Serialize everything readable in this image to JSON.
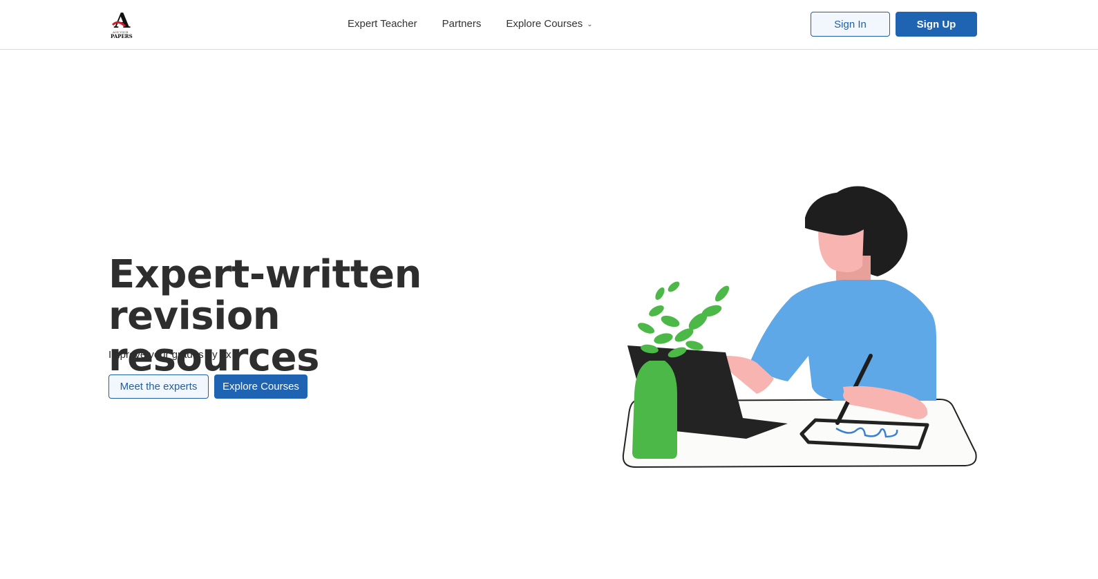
{
  "header": {
    "logo_icon": "ace-your-papers-logo",
    "logo_text": "PAPERS",
    "nav": [
      {
        "label": "Expert Teacher"
      },
      {
        "label": "Partners"
      },
      {
        "label": "Explore Courses",
        "icon": "chevron-down-icon"
      }
    ],
    "sign_in": "Sign In",
    "sign_up": "Sign Up"
  },
  "hero": {
    "title_line1": "Expert-written",
    "title_line2": "revision resources",
    "subtitle": "Improve your grades by 2x",
    "primary_button": "Meet the experts",
    "secondary_button": "Explore Courses",
    "illustration": "person-studying-at-desk-illustration"
  },
  "colors": {
    "brand_blue": "#1f63b3",
    "shirt_blue": "#5ea8e8",
    "plant_green": "#4cb847",
    "skin": "#f8b4b0",
    "dark": "#222222"
  }
}
